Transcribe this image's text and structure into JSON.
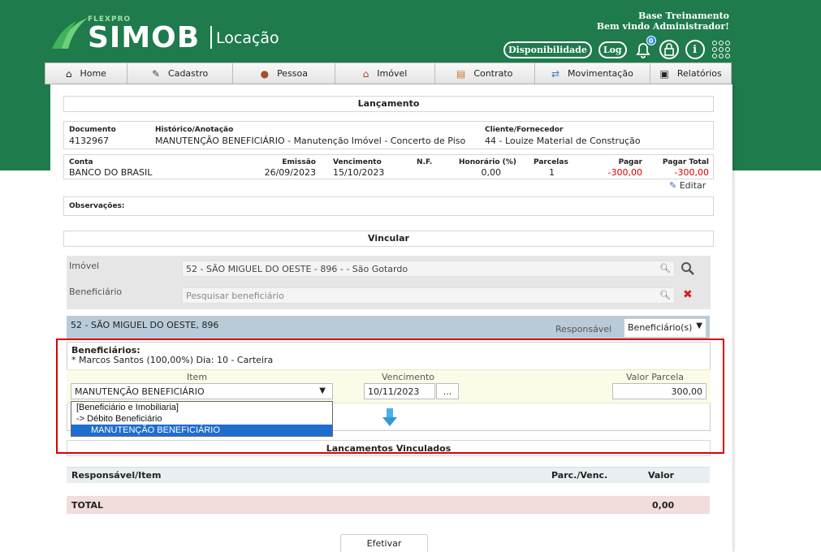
{
  "header": {
    "brand_small": "FLEXPRO",
    "brand": "SIMOB",
    "module": "Locação",
    "user_line1": "Base Treinamento",
    "user_line2": "Bem vindo Administrador!",
    "disponibilidade": "Disponibilidade",
    "log": "Log",
    "notif_count": "0",
    "icons": [
      "bell-icon",
      "lock-icon",
      "info-icon",
      "apps-grid-icon"
    ]
  },
  "nav": [
    {
      "label": "Home",
      "icon": "home-icon"
    },
    {
      "label": "Cadastro",
      "icon": "pencil-icon"
    },
    {
      "label": "Pessoa",
      "icon": "person-icon"
    },
    {
      "label": "Imóvel",
      "icon": "house-icon"
    },
    {
      "label": "Contrato",
      "icon": "contract-icon"
    },
    {
      "label": "Movimentação",
      "icon": "transfer-icon"
    },
    {
      "label": "Relatórios",
      "icon": "clipboard-icon"
    }
  ],
  "lancamento": {
    "title": "Lançamento",
    "documento_label": "Documento",
    "documento": "4132967",
    "historico_label": "Histórico/Anotação",
    "historico": "MANUTENÇÃO BENEFICIÁRIO - Manutenção Imóvel - Concerto de Piso",
    "cliente_label": "Cliente/Fornecedor",
    "cliente": "44 - Louize Material de Construção",
    "conta_label": "Conta",
    "conta": "BANCO DO BRASIL",
    "emissao_label": "Emissão",
    "emissao": "26/09/2023",
    "vencimento_label": "Vencimento",
    "vencimento": "15/10/2023",
    "nf_label": "N.F.",
    "honorario_label": "Honorário (%)",
    "honorario": "0,00",
    "parcelas_label": "Parcelas",
    "parcelas": "1",
    "pagar_label": "Pagar",
    "pagar": "-300,00",
    "pagar_total_label": "Pagar Total",
    "pagar_total": "-300,00",
    "editar": "Editar",
    "observacoes_label": "Observações:"
  },
  "vincular": {
    "title": "Vincular",
    "imovel_label": "Imóvel",
    "imovel_value": "52 - SÃO MIGUEL DO OESTE - 896 -  - São Gotardo",
    "beneficiario_label": "Beneficiário",
    "beneficiario_placeholder": "Pesquisar beneficiário"
  },
  "property": {
    "title": "52 - SÃO MIGUEL DO OESTE, 896",
    "responsavel_label": "Responsável",
    "responsavel_value": "Beneficiário(s)"
  },
  "beneficiarios": {
    "title": "Beneficiários:",
    "line": "* Marcos Santos (100,00%) Dia: 10 - Carteira",
    "item_label": "Item",
    "item_value": "MANUTENÇÃO BENEFICIÁRIO",
    "vencimento_label": "Vencimento",
    "vencimento_value": "10/11/2023",
    "date_btn": "...",
    "valor_label": "Valor Parcela",
    "valor_value": "300,00",
    "dropdown": [
      "[Beneficiário e Imobiliaria]",
      "-> Débito Beneficiário",
      "MANUTENÇÃO BENEFICIÁRIO"
    ]
  },
  "vinculados": {
    "title": "Lancamentos Vinculados",
    "col_resp": "Responsável/Item",
    "col_parc": "Parc./Venc.",
    "col_valor": "Valor",
    "total_label": "TOTAL",
    "total_value": "0,00"
  },
  "actions": {
    "efetivar": "Efetivar"
  },
  "colors": {
    "header_green": "#1f7a4c",
    "highlight_red": "#d00000",
    "negative": "#dd0000"
  }
}
